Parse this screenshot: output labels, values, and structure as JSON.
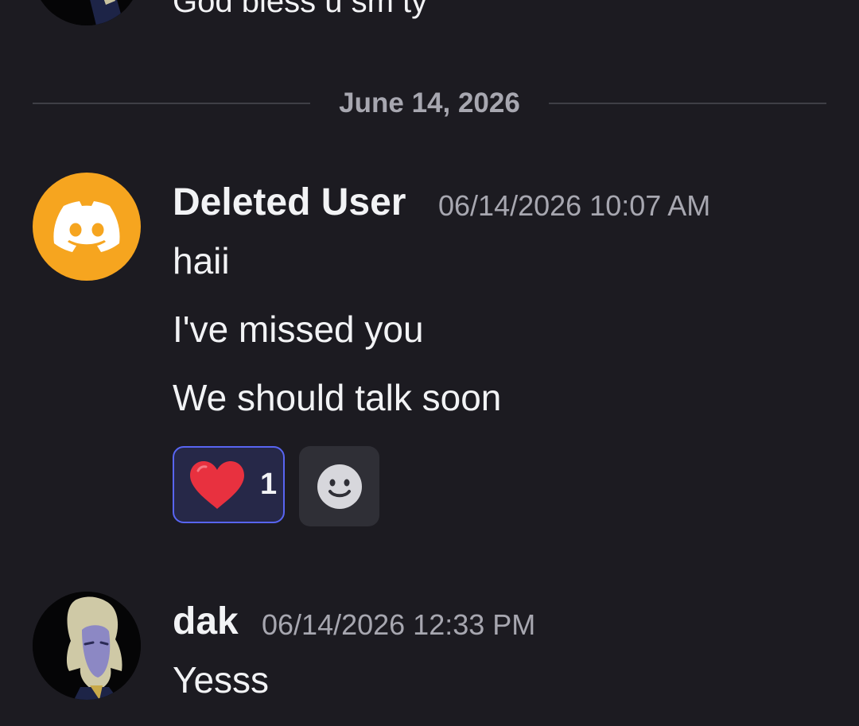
{
  "previous_message": {
    "text": "God bless u sm ty"
  },
  "date_divider": {
    "label": "June 14, 2026"
  },
  "messages": [
    {
      "author": "Deleted User",
      "timestamp": "06/14/2026 10:07 AM",
      "avatar_icon": "discord-logo-icon",
      "avatar_color": "#f6a51f",
      "lines": [
        "haii",
        "I've missed you",
        "We should talk soon"
      ],
      "reactions": [
        {
          "emoji": "red-heart-icon",
          "count": "1",
          "selected": true
        }
      ]
    },
    {
      "author": "dak",
      "timestamp": "06/14/2026 12:33 PM",
      "avatar_icon": "anime-character-avatar",
      "lines": [
        "Yesss"
      ]
    }
  ],
  "colors": {
    "background": "#1c1b21",
    "muted_text": "#a7a7b0",
    "reaction_border": "#5865f2",
    "reaction_bg": "#262848",
    "heart": "#e8313f"
  }
}
